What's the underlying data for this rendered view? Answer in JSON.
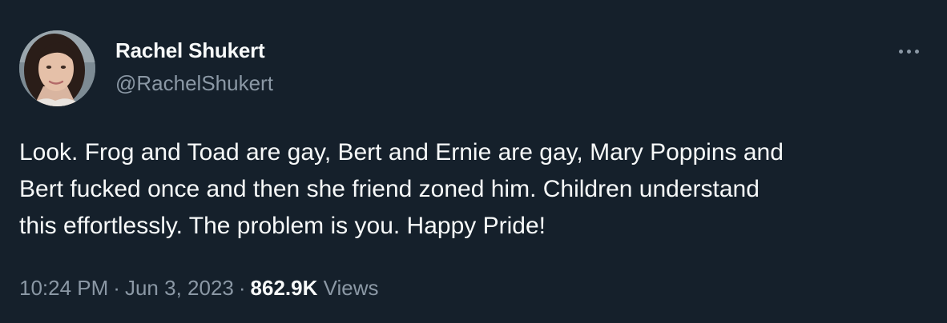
{
  "tweet": {
    "author": {
      "display_name": "Rachel Shukert",
      "handle": "@RachelShukert",
      "avatar_icon": "profile-photo"
    },
    "text": "Look. Frog and Toad are gay, Bert and Ernie are gay, Mary Poppins and\nBert fucked once and then she friend zoned him. Children understand\nthis effortlessly. The problem is you. Happy Pride!",
    "time": "10:24 PM",
    "date": "Jun 3, 2023",
    "separator": "·",
    "views_count": "862.9K",
    "views_label": "Views",
    "more_icon": "more-horizontal-icon"
  },
  "colors": {
    "background": "#15202b",
    "primary_text": "#f7f9f9",
    "secondary_text": "#8b98a5"
  }
}
